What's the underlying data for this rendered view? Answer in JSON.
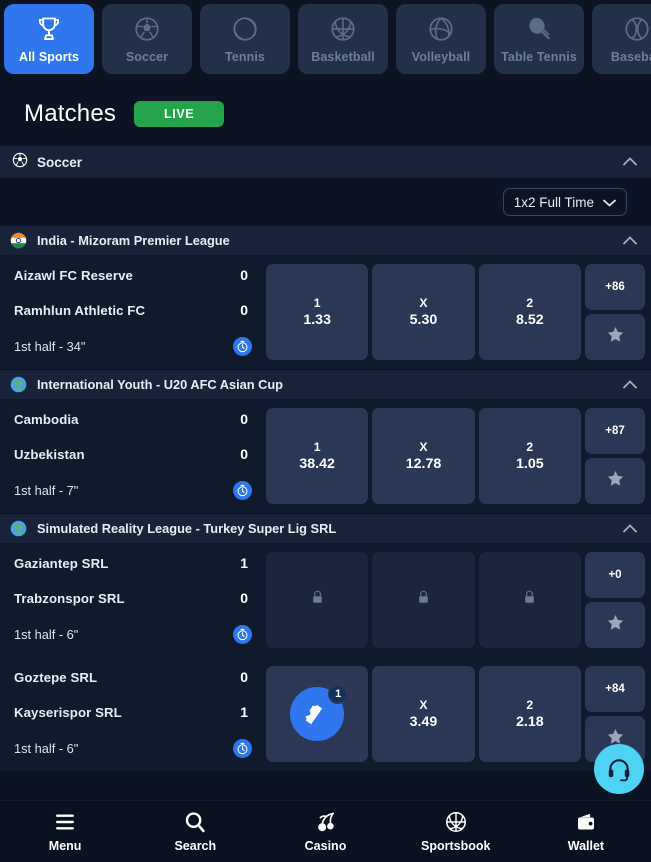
{
  "sports_tabs": [
    {
      "label": "All Sports",
      "icon": "trophy-icon",
      "active": true
    },
    {
      "label": "Soccer",
      "icon": "soccer-ball-icon",
      "active": false
    },
    {
      "label": "Tennis",
      "icon": "tennis-ball-icon",
      "active": false
    },
    {
      "label": "Basketball",
      "icon": "basketball-icon",
      "active": false
    },
    {
      "label": "Volleyball",
      "icon": "volleyball-icon",
      "active": false
    },
    {
      "label": "Table Tennis",
      "icon": "paddle-icon",
      "active": false
    },
    {
      "label": "Baseball",
      "icon": "baseball-icon",
      "active": false
    }
  ],
  "header": {
    "title": "Matches",
    "live_label": "LIVE",
    "live_color": "#26a44b"
  },
  "sport_group": {
    "title": "Soccer",
    "icon": "soccer-ball-icon",
    "collapse_icon": "chevron-up-icon"
  },
  "market_select": {
    "value": "1x2 Full Time",
    "icon": "chevron-down-icon"
  },
  "accent_color": "#2f76ef",
  "leagues": [
    {
      "title": "India - Mizoram Premier League",
      "flag": "flag-india",
      "collapse_icon": "chevron-up-icon",
      "matches": [
        {
          "home": "Aizawl FC Reserve",
          "away": "Ramhlun Athletic FC",
          "home_score": "0",
          "away_score": "0",
          "status": "1st half - 34\"",
          "timer_icon": "stopwatch-icon",
          "odds": [
            {
              "key": "1",
              "value": "1.33",
              "locked": false,
              "selected": false
            },
            {
              "key": "X",
              "value": "5.30",
              "locked": false,
              "selected": false
            },
            {
              "key": "2",
              "value": "8.52",
              "locked": false,
              "selected": false
            }
          ],
          "more_markets": "+86",
          "favorite_icon": "star-icon"
        }
      ]
    },
    {
      "title": "International Youth - U20 AFC Asian Cup",
      "flag": "globe",
      "collapse_icon": "chevron-up-icon",
      "matches": [
        {
          "home": "Cambodia",
          "away": "Uzbekistan",
          "home_score": "0",
          "away_score": "0",
          "status": "1st half - 7\"",
          "timer_icon": "stopwatch-icon",
          "odds": [
            {
              "key": "1",
              "value": "38.42",
              "locked": false,
              "selected": false
            },
            {
              "key": "X",
              "value": "12.78",
              "locked": false,
              "selected": false
            },
            {
              "key": "2",
              "value": "1.05",
              "locked": false,
              "selected": false
            }
          ],
          "more_markets": "+87",
          "favorite_icon": "star-icon"
        }
      ]
    },
    {
      "title": "Simulated Reality League - Turkey Super Lig SRL",
      "flag": "globe",
      "collapse_icon": "chevron-up-icon",
      "matches": [
        {
          "home": "Gaziantep SRL",
          "away": "Trabzonspor SRL",
          "home_score": "1",
          "away_score": "0",
          "status": "1st half - 6\"",
          "timer_icon": "stopwatch-icon",
          "odds": [
            {
              "key": "",
              "value": "",
              "locked": true,
              "selected": false
            },
            {
              "key": "",
              "value": "",
              "locked": true,
              "selected": false
            },
            {
              "key": "",
              "value": "",
              "locked": true,
              "selected": false
            }
          ],
          "more_markets": "+0",
          "favorite_icon": "star-icon"
        },
        {
          "home": "Goztepe SRL",
          "away": "Kayserispor SRL",
          "home_score": "0",
          "away_score": "1",
          "status": "1st half - 6\"",
          "timer_icon": "stopwatch-icon",
          "odds": [
            {
              "key": "",
              "value": "",
              "locked": false,
              "selected": true,
              "badge": "1",
              "selected_icon": "bet-slip-ticket-icon"
            },
            {
              "key": "X",
              "value": "3.49",
              "locked": false,
              "selected": false
            },
            {
              "key": "2",
              "value": "2.18",
              "locked": false,
              "selected": false
            }
          ],
          "more_markets": "+84",
          "favorite_icon": "star-icon"
        }
      ]
    }
  ],
  "support_button": {
    "icon": "headset-icon",
    "color": "#4fd3f5"
  },
  "bottom_nav": [
    {
      "label": "Menu",
      "icon": "hamburger-icon"
    },
    {
      "label": "Search",
      "icon": "magnifier-icon"
    },
    {
      "label": "Casino",
      "icon": "cherries-icon"
    },
    {
      "label": "Sportsbook",
      "icon": "basketball-icon"
    },
    {
      "label": "Wallet",
      "icon": "wallet-icon"
    }
  ]
}
